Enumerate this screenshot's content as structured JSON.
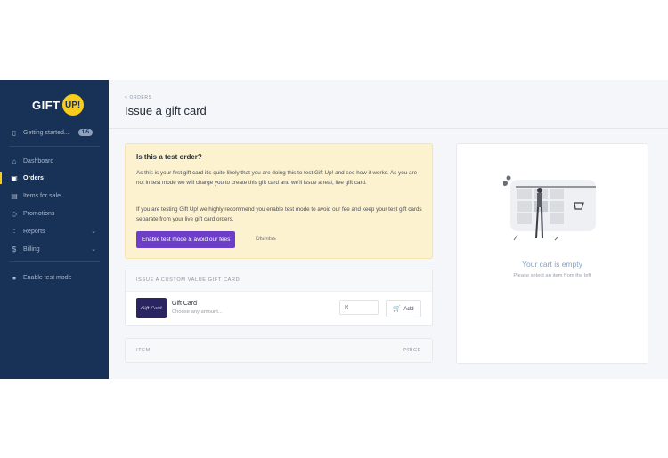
{
  "brand": {
    "logo_text": "GIFT",
    "logo_badge": "UP!"
  },
  "sidebar": {
    "getting_started": {
      "label": "Getting started...",
      "progress": "1/5",
      "icon": "clipboard-icon"
    },
    "items": [
      {
        "label": "Dashboard",
        "icon": "home-icon"
      },
      {
        "label": "Orders",
        "icon": "inbox-icon",
        "active": true
      },
      {
        "label": "Items for sale",
        "icon": "book-icon"
      },
      {
        "label": "Promotions",
        "icon": "tag-icon"
      },
      {
        "label": "Reports",
        "icon": "bar-chart-icon",
        "expandable": true
      },
      {
        "label": "Billing",
        "icon": "dollar-icon",
        "expandable": true
      }
    ],
    "test_mode": {
      "label": "Enable test mode",
      "icon": "toggle-icon"
    }
  },
  "main": {
    "breadcrumb": "< ORDERS",
    "title": "Issue a gift card",
    "alert": {
      "heading": "Is this a test order?",
      "paragraph1": "As this is your first gift card it's quite likely that you are doing this to test Gift Up! and see how it works. As you are not in test mode we will charge you to create this gift card and we'll issue a real, live gift card.",
      "paragraph2": "If you are testing Gift Up! we highly recommend you enable test mode to avoid our fee and keep your test gift cards separate from your live gift card orders.",
      "primary_button": "Enable test mode & avoid our fees",
      "dismiss": "Dismiss"
    },
    "custom_card": {
      "header": "ISSUE A CUSTOM VALUE GIFT CARD",
      "thumbnail_text": "Gift Card",
      "name": "Gift Card",
      "subtitle": "Choose any amount...",
      "amount_placeholder": "R",
      "add_label": "Add"
    },
    "items_table": {
      "col_item": "ITEM",
      "col_price": "PRICE"
    }
  },
  "cart": {
    "empty_title": "Your cart is empty",
    "empty_subtitle": "Please select an item from the left"
  },
  "colors": {
    "sidebar": "#173157",
    "accent": "#6d3fc9",
    "logo": "#f7cc1d",
    "alert_bg": "#fdf2cf"
  }
}
